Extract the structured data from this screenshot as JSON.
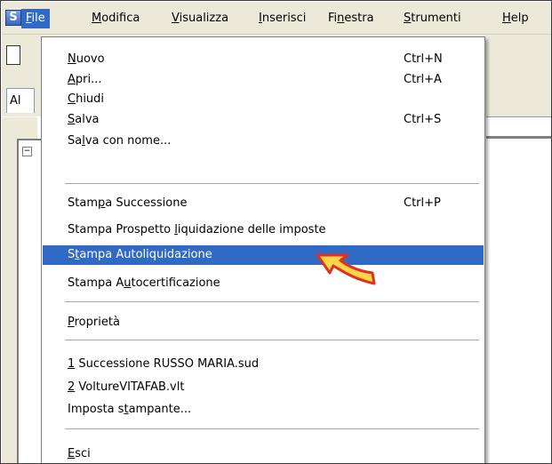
{
  "app": {
    "icon_letter": "S"
  },
  "menubar": {
    "items": [
      {
        "pre": "",
        "key": "F",
        "post": "ile"
      },
      {
        "pre": "",
        "key": "M",
        "post": "odifica"
      },
      {
        "pre": "",
        "key": "V",
        "post": "isualizza"
      },
      {
        "pre": "",
        "key": "I",
        "post": "nserisci"
      },
      {
        "pre": "Fi",
        "key": "n",
        "post": "estra"
      },
      {
        "pre": "",
        "key": "S",
        "post": "trumenti"
      },
      {
        "pre": "",
        "key": "H",
        "post": "elp"
      }
    ]
  },
  "background": {
    "tab_label": "Al",
    "tree_expander": "−"
  },
  "file_menu": {
    "items": [
      {
        "pre": "",
        "key": "N",
        "post": "uovo",
        "shortcut": "Ctrl+N"
      },
      {
        "pre": "",
        "key": "A",
        "post": "pri...",
        "shortcut": "Ctrl+A"
      },
      {
        "pre": "",
        "key": "C",
        "post": "hiudi",
        "shortcut": ""
      },
      {
        "pre": "",
        "key": "S",
        "post": "alva",
        "shortcut": "Ctrl+S"
      },
      {
        "pre": "Sa",
        "key": "l",
        "post": "va con nome...",
        "shortcut": ""
      },
      {
        "pre": "Stam",
        "key": "p",
        "post": "a Successione",
        "shortcut": "Ctrl+P"
      },
      {
        "pre": "Stampa Prospetto ",
        "key": "l",
        "post": "iquidazione delle imposte",
        "shortcut": ""
      },
      {
        "pre": "S",
        "key": "t",
        "post": "ampa Autoliquidazione",
        "shortcut": ""
      },
      {
        "pre": "Stampa A",
        "key": "u",
        "post": "tocertificazione",
        "shortcut": ""
      },
      {
        "pre": "",
        "key": "P",
        "post": "roprietà",
        "shortcut": ""
      },
      {
        "pre": "",
        "key": "1",
        "post": " Successione RUSSO MARIA.sud",
        "shortcut": ""
      },
      {
        "pre": "",
        "key": "2",
        "post": " VoltureVITAFAB.vlt",
        "shortcut": ""
      },
      {
        "pre": "Imposta s",
        "key": "t",
        "post": "ampante...",
        "shortcut": ""
      },
      {
        "pre": "",
        "key": "E",
        "post": "sci",
        "shortcut": ""
      }
    ],
    "highlighted_index": 7
  },
  "colors": {
    "highlight": "#316ac5",
    "arrow_fill": "#ffd54a",
    "arrow_stroke": "#e0301e"
  },
  "icons": {
    "pointer_arrow": "arrow-pointer-icon"
  }
}
